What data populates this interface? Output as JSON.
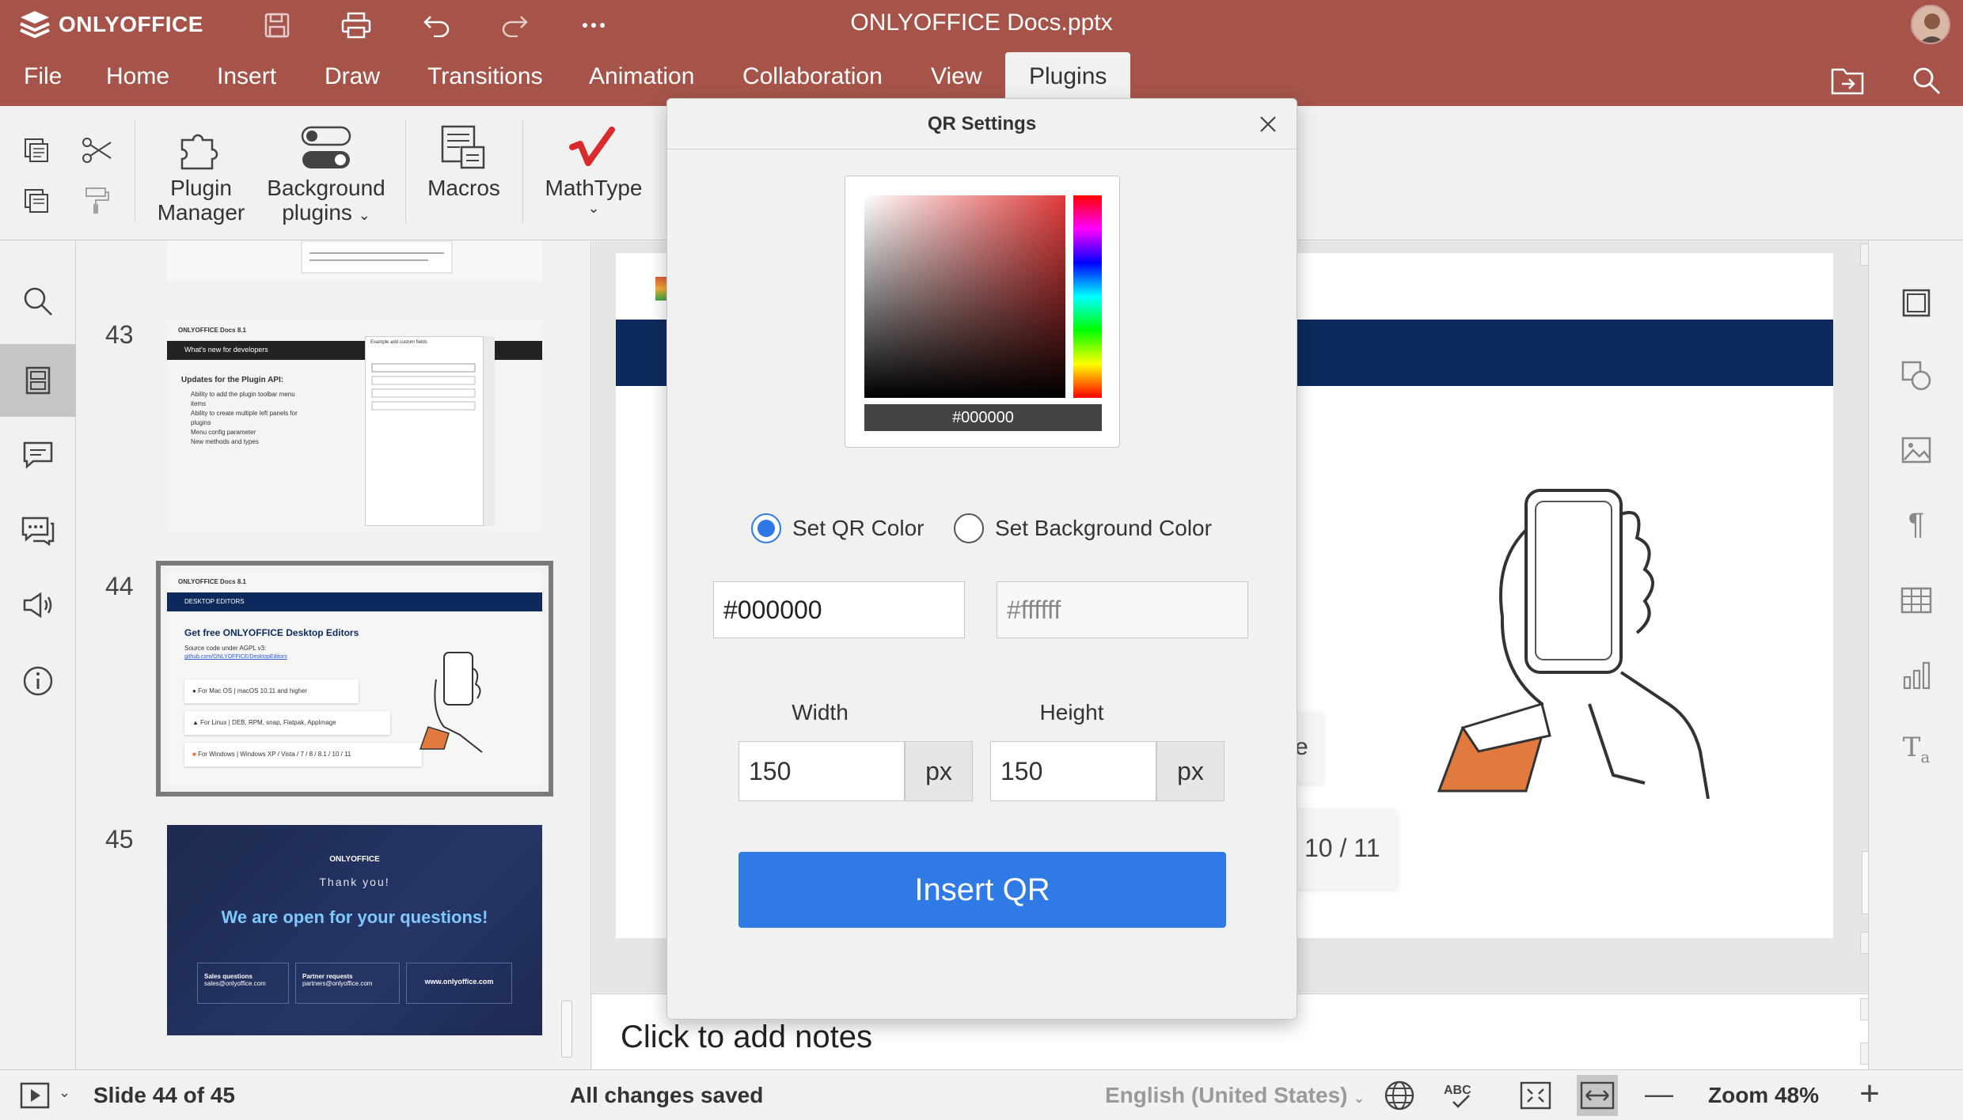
{
  "app": {
    "name": "ONLYOFFICE",
    "document_title": "ONLYOFFICE Docs.pptx"
  },
  "menu_tabs": [
    "File",
    "Home",
    "Insert",
    "Draw",
    "Transitions",
    "Animation",
    "Collaboration",
    "View",
    "Plugins"
  ],
  "active_tab": "Plugins",
  "toolbar": {
    "plugin_manager": "Plugin Manager",
    "plugin_manager_l1": "Plugin",
    "plugin_manager_l2": "Manager",
    "background_plugins_l1": "Background",
    "background_plugins_l2": "plugins",
    "macros": "Macros",
    "mathtype": "MathType"
  },
  "slides_panel": {
    "slides": [
      {
        "number": "43"
      },
      {
        "number": "44"
      },
      {
        "number": "45"
      }
    ],
    "thumb43": {
      "brand": "ONLYOFFICE Docs 8.1",
      "header": "What's new for developers",
      "heading": "Updates for the Plugin API:",
      "bullets": [
        "Ability to add the plugin toolbar menu items",
        "Ability to create multiple left panels for plugins",
        "Menu config parameter",
        "New methods and types"
      ],
      "dialog_title": "Example add custom fields"
    },
    "thumb44": {
      "brand": "ONLYOFFICE Docs 8.1",
      "header": "DESKTOP EDITORS",
      "heading": "Get free ONLYOFFICE Desktop Editors",
      "sub": "Source code under AGPL v3:",
      "link": "github.com/ONLYOFFICE/DesktopEditors",
      "rows": [
        {
          "os": "For Mac OS",
          "detail": "macOS 10.11 and higher"
        },
        {
          "os": "For Linux",
          "detail": "DEB, RPM, snap, Flatpak, AppImage"
        },
        {
          "os": "For Windows",
          "detail": "Windows XP / Vista / 7 / 8 / 8.1 / 10 / 11"
        }
      ]
    },
    "thumb45": {
      "brand": "ONLYOFFICE",
      "thanks": "Thank you!",
      "headline": "We are open for your questions!",
      "boxes": [
        {
          "title": "Sales questions",
          "value": "sales@onlyoffice.com"
        },
        {
          "title": "Partner requests",
          "value": "partners@onlyoffice.com"
        },
        {
          "title": "www.onlyoffice.com",
          "value": ""
        }
      ]
    }
  },
  "editor": {
    "notes_placeholder": "Click to add notes",
    "partial_text": "e",
    "partial_counter": "10 / 11"
  },
  "statusbar": {
    "slide_info": "Slide 44 of 45",
    "save_status": "All changes saved",
    "language": "English (United States)",
    "zoom": "Zoom 48%"
  },
  "modal": {
    "title": "QR Settings",
    "picker_hex": "#000000",
    "radio_qr": "Set QR Color",
    "radio_bg": "Set Background Color",
    "selected_radio": "qr",
    "qr_color_value": "#000000",
    "bg_color_value": "#ffffff",
    "width_label": "Width",
    "height_label": "Height",
    "width_value": "150",
    "height_value": "150",
    "unit": "px",
    "insert_button": "Insert QR"
  },
  "colors": {
    "topbar": "#a6544a",
    "accent_blue": "#2f7ae5",
    "slide_band": "#0e2a5c"
  }
}
